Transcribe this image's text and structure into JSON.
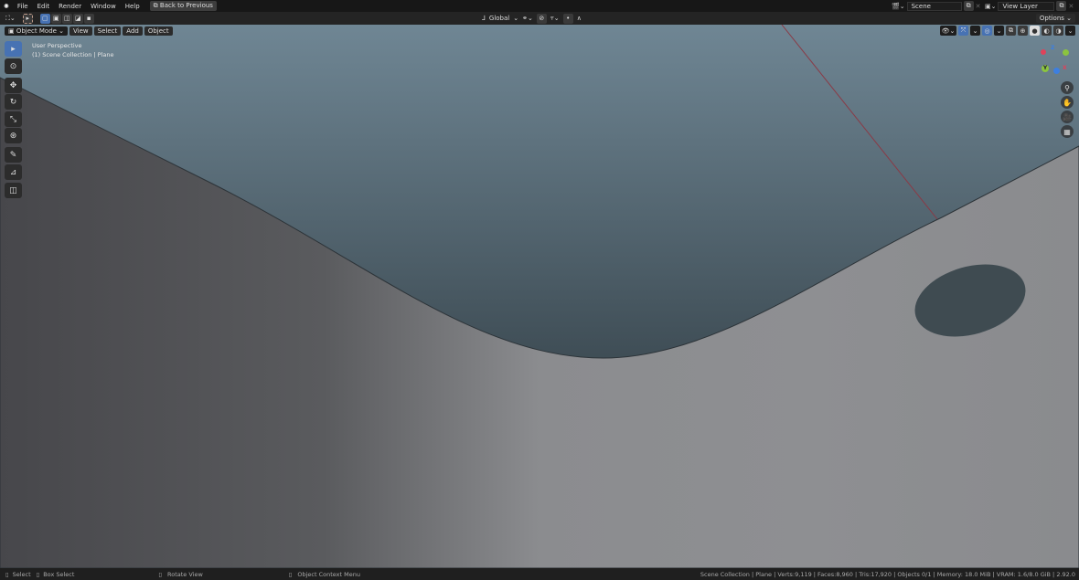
{
  "menu": {
    "items": [
      "File",
      "Edit",
      "Render",
      "Window",
      "Help"
    ],
    "back_button": "Back to Previous"
  },
  "scene": {
    "label": "Scene",
    "view_layer": "View Layer"
  },
  "header": {
    "orientation": "Global",
    "options": "Options"
  },
  "viewport_header": {
    "mode": "Object Mode",
    "menus": [
      "View",
      "Select",
      "Add",
      "Object"
    ]
  },
  "overlay": {
    "perspective": "User Perspective",
    "collection": "(1) Scene Collection | Plane"
  },
  "gizmo": {
    "z": "Z",
    "y": "Y",
    "x": "X"
  },
  "status": {
    "select": "Select",
    "box_select": "Box Select",
    "rotate": "Rotate View",
    "context": "Object Context Menu",
    "stats": "Scene Collection | Plane | Verts:9,119 | Faces:8,960 | Tris:17,920 | Objects 0/1 | Memory: 18.0 MiB | VRAM: 1.6/8.0 GiB | 2.92.0"
  },
  "colors": {
    "accent": "#4772b3",
    "axis_x": "#e0425a",
    "axis_y": "#8bc43f",
    "axis_z": "#3d7fe0"
  }
}
